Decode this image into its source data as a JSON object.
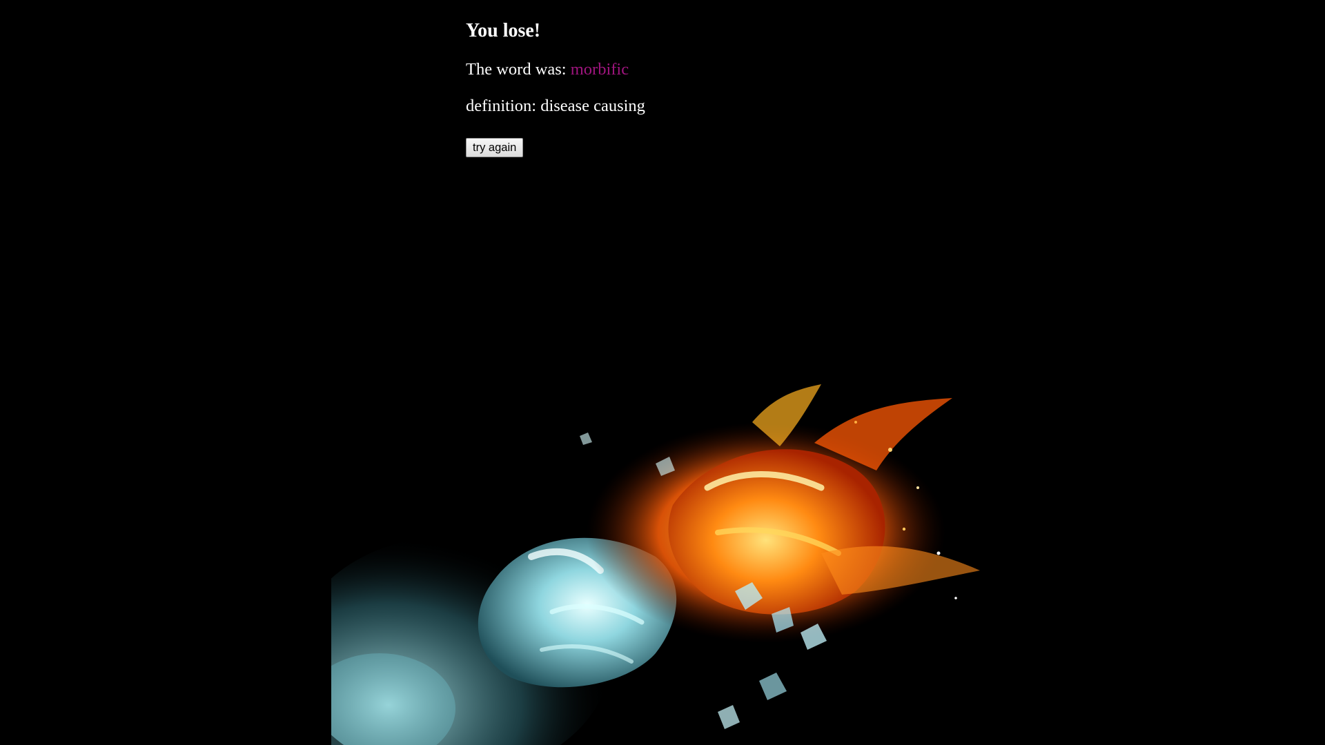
{
  "result": {
    "title": "You lose!",
    "word_prefix": "The word was: ",
    "word": "morbific",
    "definition_prefix": "definition: ",
    "definition": "disease causing"
  },
  "actions": {
    "try_again_label": "try again"
  },
  "hero_image": {
    "subject": "ice fist and fire fist colliding",
    "icon": "fire-vs-ice-fists-illustration"
  },
  "colors": {
    "background": "#000000",
    "text": "#ffffff",
    "word_highlight": "#a0157f",
    "fire": "#ff7a10",
    "ice": "#9fe6ee"
  }
}
